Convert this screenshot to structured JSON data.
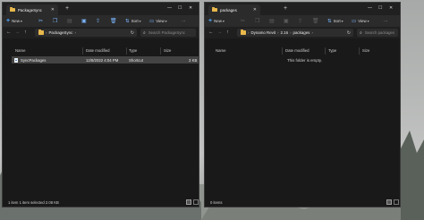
{
  "window1": {
    "tab_title": "PackageSync",
    "commands": {
      "new": "New",
      "sort": "Sort",
      "view": "View",
      "more": "···"
    },
    "breadcrumb": [
      "PackageSync"
    ],
    "search_placeholder": "Search PackageSync",
    "columns": [
      "Name",
      "Date modified",
      "Type",
      "Size"
    ],
    "rows": [
      {
        "name": "SyncPackages",
        "date": "12/8/2022 4:04 PM",
        "type": "Shortcut",
        "size": "3 KB"
      }
    ],
    "status": "1 item   1 item selected  2.08 KB"
  },
  "window2": {
    "tab_title": "packages",
    "commands": {
      "new": "New",
      "sort": "Sort",
      "view": "View",
      "more": "···"
    },
    "breadcrumb": [
      "Dynamo Revit",
      "2.16",
      "packages"
    ],
    "search_placeholder": "Search packages",
    "columns": [
      "Name",
      "Date modified",
      "Type",
      "Size"
    ],
    "empty_message": "This folder is empty.",
    "status": "0 items"
  },
  "icons": {
    "new": "plus-icon",
    "cut": "scissors-icon",
    "copy": "copy-icon",
    "paste": "paste-icon",
    "rename": "rename-icon",
    "share": "share-icon",
    "delete": "trash-icon",
    "sort": "sort-icon",
    "view": "view-icon",
    "back": "arrow-left-icon",
    "forward": "arrow-right-icon",
    "up": "arrow-up-icon",
    "refresh": "refresh-icon",
    "search": "search-icon",
    "details_view": "details-view-icon",
    "tiles_view": "tiles-view-icon"
  },
  "colors": {
    "window_bg": "#191919",
    "command_bar": "#2b2b2b",
    "accent": "#4fa8ff",
    "folder": "#e8b84c",
    "selection": "#434343"
  }
}
